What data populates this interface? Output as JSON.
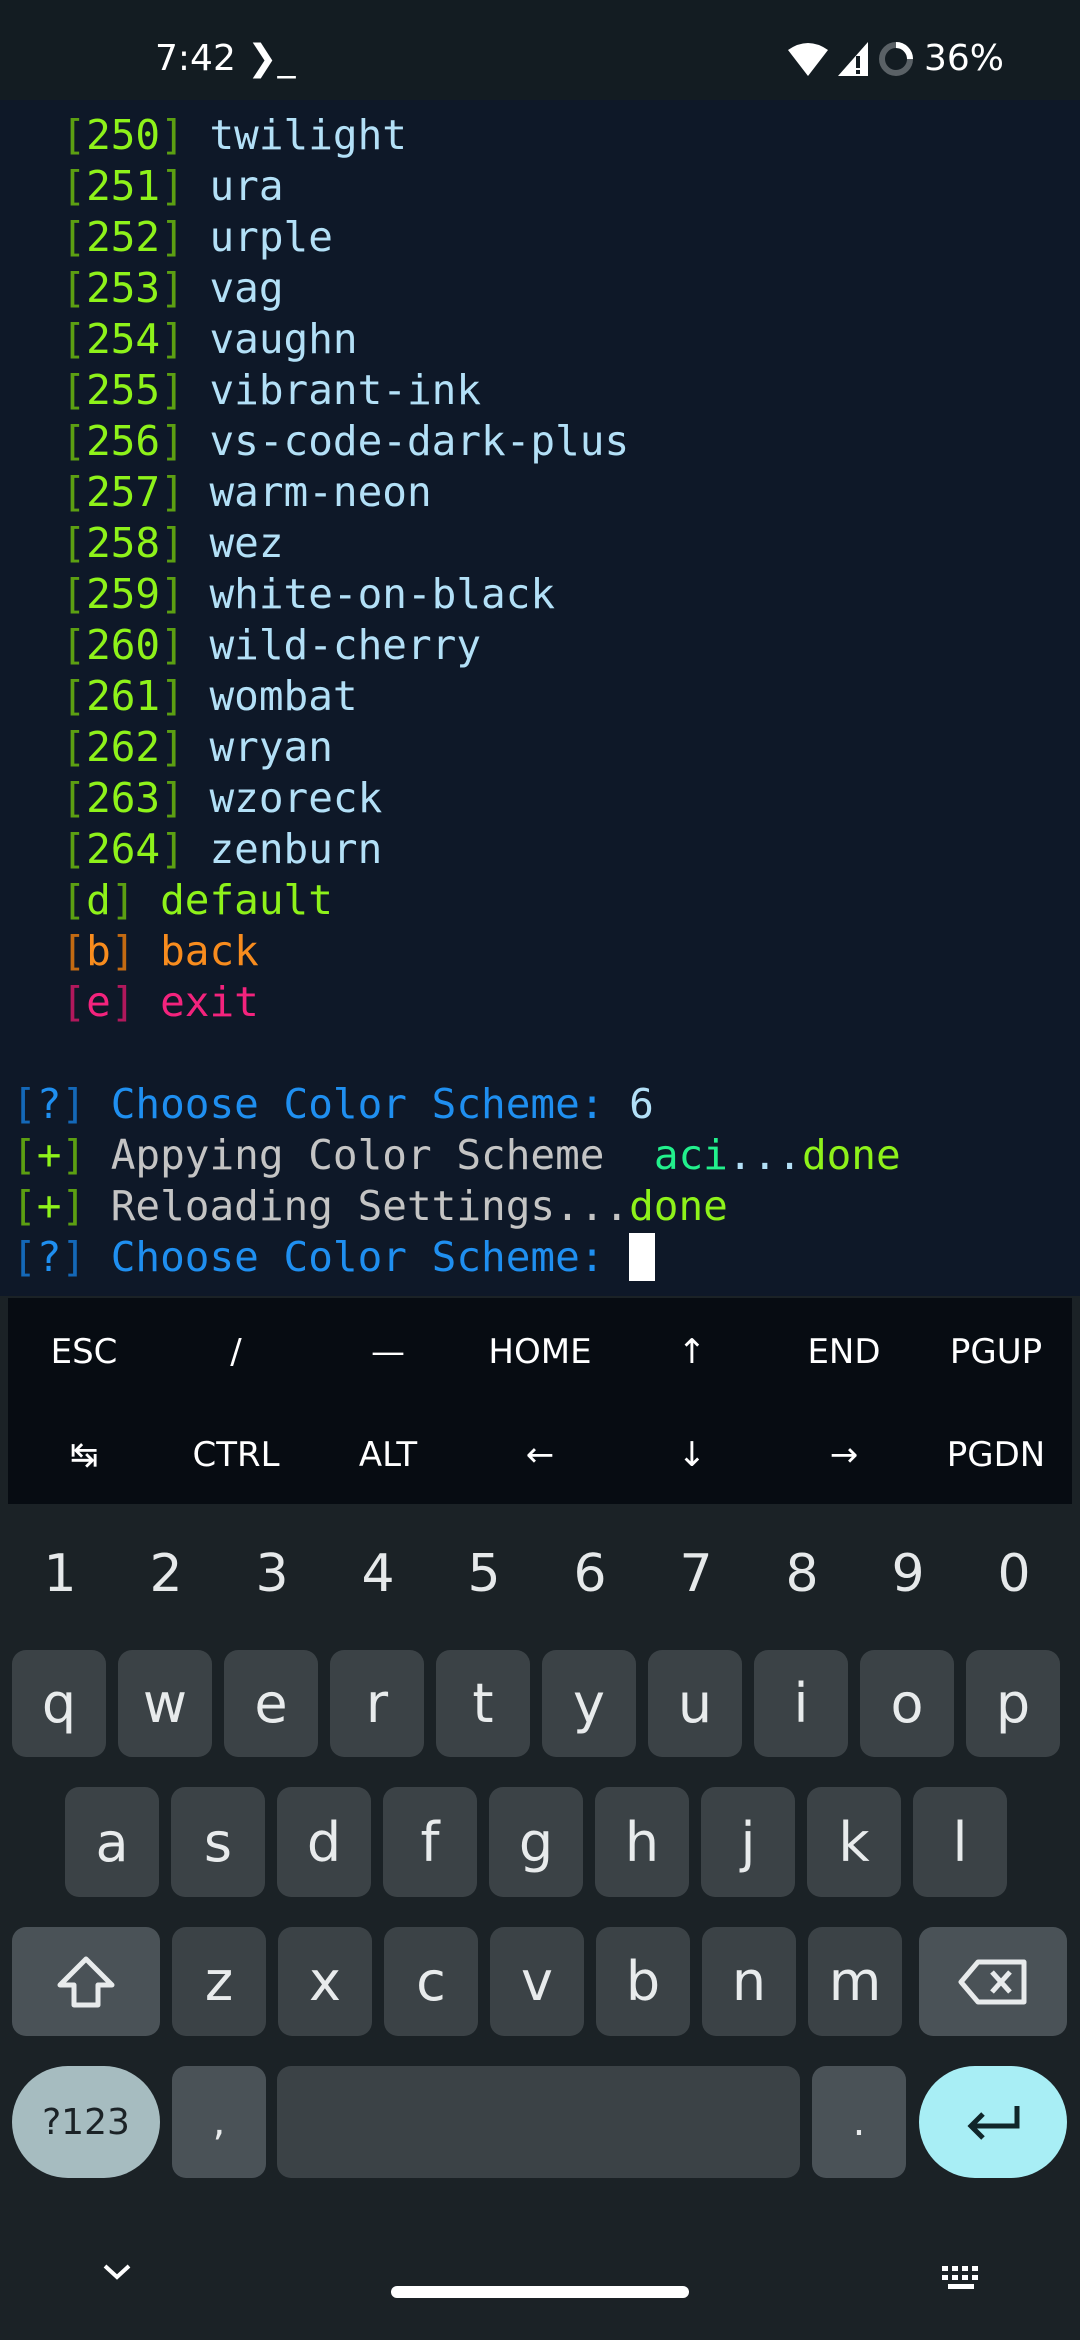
{
  "status_bar": {
    "time": "7:42",
    "terminal_icon": "terminal-prompt-icon",
    "battery": "36%",
    "icons": [
      "wifi-icon",
      "signal-icon",
      "battery-ring-icon"
    ]
  },
  "terminal": {
    "schemes": [
      {
        "num": "250",
        "name": "twilight"
      },
      {
        "num": "251",
        "name": "ura"
      },
      {
        "num": "252",
        "name": "urple"
      },
      {
        "num": "253",
        "name": "vag"
      },
      {
        "num": "254",
        "name": "vaughn"
      },
      {
        "num": "255",
        "name": "vibrant-ink"
      },
      {
        "num": "256",
        "name": "vs-code-dark-plus"
      },
      {
        "num": "257",
        "name": "warm-neon"
      },
      {
        "num": "258",
        "name": "wez"
      },
      {
        "num": "259",
        "name": "white-on-black"
      },
      {
        "num": "260",
        "name": "wild-cherry"
      },
      {
        "num": "261",
        "name": "wombat"
      },
      {
        "num": "262",
        "name": "wryan"
      },
      {
        "num": "263",
        "name": "wzoreck"
      },
      {
        "num": "264",
        "name": "zenburn"
      }
    ],
    "options": [
      {
        "key": "d",
        "label": "default"
      },
      {
        "key": "b",
        "label": "back"
      },
      {
        "key": "e",
        "label": "exit"
      }
    ],
    "prompt1": {
      "mark": "?",
      "text": "Choose Color Scheme:",
      "value": "6"
    },
    "apply": {
      "mark": "+",
      "text": "Appying Color Scheme ",
      "scheme": "aci",
      "dots": "...",
      "done": "done"
    },
    "reload": {
      "mark": "+",
      "text": "Reloading Settings...",
      "done": "done"
    },
    "prompt2": {
      "mark": "?",
      "text": "Choose Color Scheme:"
    }
  },
  "extra_keys": [
    [
      "ESC",
      "/",
      "—",
      "HOME",
      "↑",
      "END",
      "PGUP"
    ],
    [
      "↹",
      "CTRL",
      "ALT",
      "←",
      "↓",
      "→",
      "PGDN"
    ]
  ],
  "keyboard": {
    "numbers": [
      "1",
      "2",
      "3",
      "4",
      "5",
      "6",
      "7",
      "8",
      "9",
      "0"
    ],
    "row1": [
      "q",
      "w",
      "e",
      "r",
      "t",
      "y",
      "u",
      "i",
      "o",
      "p"
    ],
    "row2": [
      "a",
      "s",
      "d",
      "f",
      "g",
      "h",
      "j",
      "k",
      "l"
    ],
    "row3": [
      "z",
      "x",
      "c",
      "v",
      "b",
      "n",
      "m"
    ],
    "symbols": "?123",
    "comma": ",",
    "period": ".",
    "colors": {
      "enter": "#a8eef5",
      "symbols": "#a6bcc0"
    }
  }
}
